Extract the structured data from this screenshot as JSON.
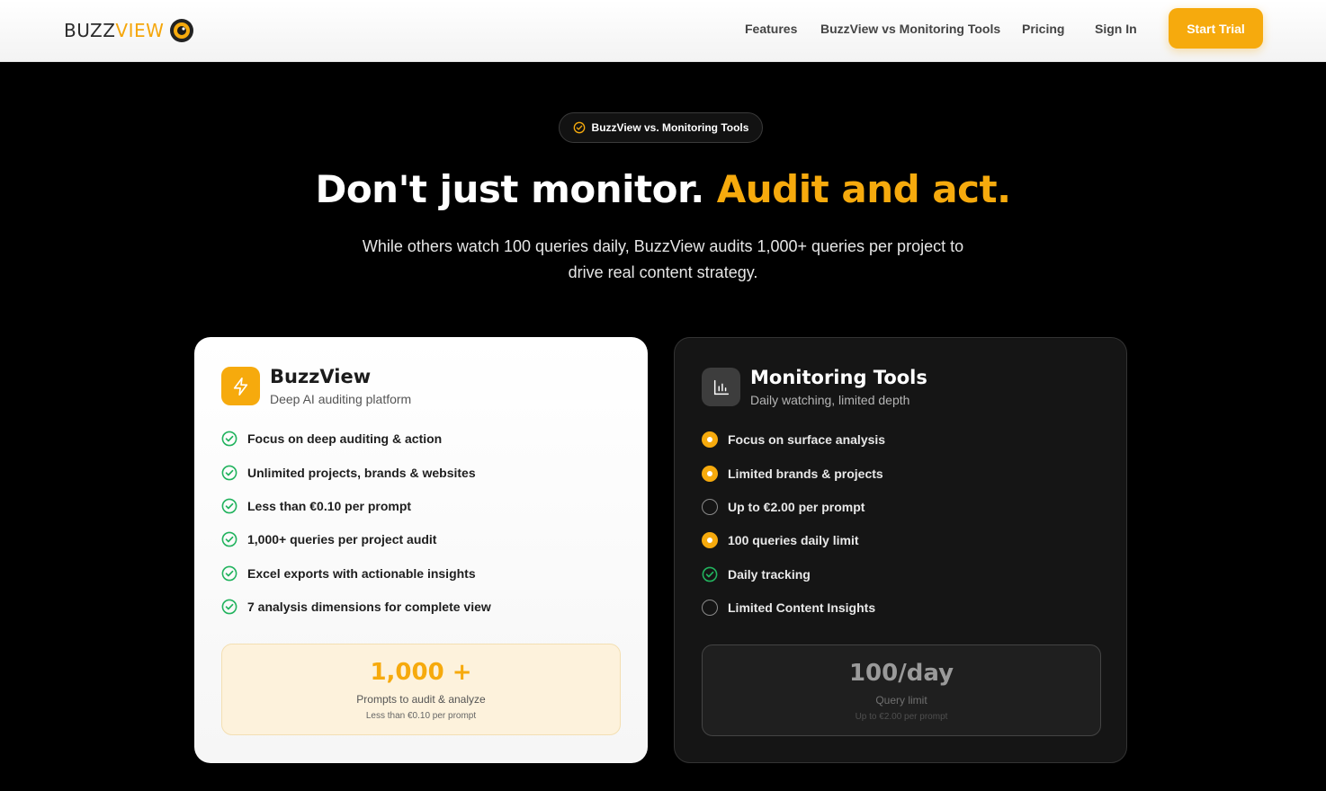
{
  "nav": {
    "logo": {
      "part1": "BUZZ",
      "part2": "VIEW",
      "icon": "eye-icon"
    },
    "links": [
      "Features",
      "BuzzView vs Monitoring Tools",
      "Pricing",
      "Sign In"
    ],
    "cta": "Start Trial"
  },
  "hero": {
    "badge": "BuzzView vs. Monitoring Tools",
    "headline_white": "Don't just monitor.",
    "headline_accent": "Audit and act.",
    "subtitle": "While others watch 100 queries daily, BuzzView audits 1,000+ queries per project to drive real content strategy."
  },
  "buzzview_card": {
    "icon": "lightning-icon",
    "title": "BuzzView",
    "subtitle": "Deep AI auditing platform",
    "features": [
      {
        "text": "Focus on deep auditing & action",
        "status": "check"
      },
      {
        "text": "Unlimited projects, brands & websites",
        "status": "check"
      },
      {
        "text": "Less than €0.10 per prompt",
        "status": "check"
      },
      {
        "text": "1,000+ queries per project audit",
        "status": "check"
      },
      {
        "text": "Excel exports with actionable insights",
        "status": "check"
      },
      {
        "text": "7 analysis dimensions for complete view",
        "status": "check"
      }
    ],
    "stat": {
      "value": "1,000 +",
      "label": "Prompts to audit & analyze",
      "note": "Less than €0.10 per prompt"
    }
  },
  "monitoring_card": {
    "icon": "bar-chart-icon",
    "title": "Monitoring Tools",
    "subtitle": "Daily watching, limited depth",
    "features": [
      {
        "text": "Focus on surface analysis",
        "status": "filled"
      },
      {
        "text": "Limited brands & projects",
        "status": "filled"
      },
      {
        "text": "Up to €2.00 per prompt",
        "status": "empty"
      },
      {
        "text": "100 queries daily limit",
        "status": "filled"
      },
      {
        "text": "Daily tracking",
        "status": "check"
      },
      {
        "text": "Limited Content Insights",
        "status": "empty"
      }
    ],
    "stat": {
      "value": "100/day",
      "label": "Query limit",
      "note": "Up to €2.00 per prompt"
    }
  },
  "colors": {
    "accent": "#f6aa0d",
    "check_green": "#22b35e",
    "background": "#000000"
  }
}
